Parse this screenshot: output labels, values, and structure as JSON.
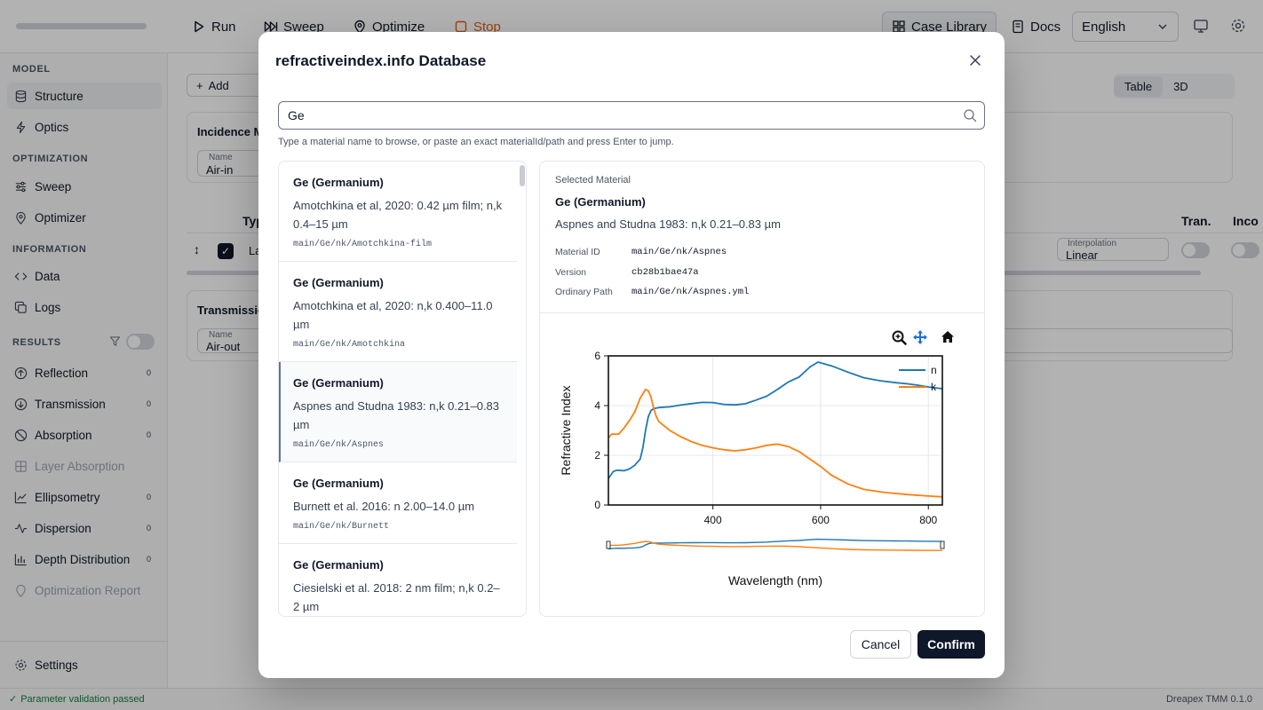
{
  "toolbar": {
    "run": "Run",
    "sweep": "Sweep",
    "optimize": "Optimize",
    "stop": "Stop",
    "case_library": "Case Library",
    "docs": "Docs",
    "language": "English"
  },
  "sidebar": {
    "model_heading": "MODEL",
    "structure": "Structure",
    "optics": "Optics",
    "optimization_heading": "OPTIMIZATION",
    "sweep": "Sweep",
    "optimizer": "Optimizer",
    "information_heading": "INFORMATION",
    "data": "Data",
    "logs": "Logs",
    "results_heading": "RESULTS",
    "reflection": "Reflection",
    "reflection_count": "0",
    "transmission": "Transmission",
    "transmission_count": "0",
    "absorption": "Absorption",
    "absorption_count": "0",
    "layer_absorption": "Layer Absorption",
    "ellipsometry": "Ellipsometry",
    "ellipsometry_count": "0",
    "dispersion": "Dispersion",
    "dispersion_count": "0",
    "depth_distribution": "Depth Distribution",
    "depth_distribution_count": "0",
    "optimization_report": "Optimization Report",
    "settings": "Settings"
  },
  "main": {
    "add_label": "Add",
    "view_table": "Table",
    "view_3d": "3D",
    "incidence_title": "Incidence M",
    "incidence_name_label": "Name",
    "incidence_name_value": "Air-in",
    "transmission_title": "Transmissic",
    "transmission_name_label": "Name",
    "transmission_name_value": "Air-out",
    "col_type": "Typ",
    "col_tran": "Tran.",
    "col_inco": "Inco",
    "layer_name": "La",
    "interpolation_label": "Interpolation",
    "interpolation_value": "Linear"
  },
  "status": {
    "validation": "Parameter validation passed",
    "version": "Dreapex TMM 0.1.0"
  },
  "modal": {
    "title": "refractiveindex.info Database",
    "search_value": "Ge",
    "hint": "Type a material name to browse, or paste an exact materialId/path and press Enter to jump.",
    "results": [
      {
        "title": "Ge (Germanium)",
        "desc": "Amotchkina et al, 2020: 0.42 µm film; n,k 0.4–15 µm",
        "path": "main/Ge/nk/Amotchkina-film"
      },
      {
        "title": "Ge (Germanium)",
        "desc": "Amotchkina et al, 2020: n,k 0.400–11.0 µm",
        "path": "main/Ge/nk/Amotchkina"
      },
      {
        "title": "Ge (Germanium)",
        "desc": "Aspnes and Studna 1983: n,k 0.21–0.83 µm",
        "path": "main/Ge/nk/Aspnes"
      },
      {
        "title": "Ge (Germanium)",
        "desc": "Burnett et al. 2016: n 2.00–14.0 µm",
        "path": "main/Ge/nk/Burnett"
      },
      {
        "title": "Ge (Germanium)",
        "desc": "Ciesielski et al. 2018: 2 nm film; n,k 0.2–2 µm",
        "path": ""
      }
    ],
    "selected": {
      "label": "Selected Material",
      "name": "Ge (Germanium)",
      "desc": "Aspnes and Studna 1983: n,k 0.21–0.83 µm",
      "material_id_label": "Material ID",
      "material_id": "main/Ge/nk/Aspnes",
      "version_label": "Version",
      "version": "cb28b1bae47a",
      "path_label": "Ordinary Path",
      "path": "main/Ge/nk/Aspnes.yml"
    },
    "cancel": "Cancel",
    "confirm": "Confirm"
  },
  "chart_data": {
    "type": "line",
    "xlabel": "Wavelength (nm)",
    "ylabel": "Refractive Index",
    "xlim": [
      206,
      826
    ],
    "ylim": [
      0,
      6
    ],
    "xticks": [
      400,
      600,
      800
    ],
    "yticks": [
      0,
      2,
      4,
      6
    ],
    "grid": true,
    "legend_position": "top-right",
    "series": [
      {
        "name": "n",
        "color": "#1f77b4",
        "x": [
          206,
          215,
          222,
          235,
          245,
          255,
          265,
          270,
          275,
          280,
          285,
          290,
          295,
          300,
          320,
          340,
          360,
          380,
          400,
          420,
          440,
          460,
          480,
          500,
          520,
          540,
          560,
          580,
          595,
          620,
          650,
          680,
          710,
          740,
          760,
          780,
          800,
          826
        ],
        "y": [
          1.06,
          1.35,
          1.4,
          1.38,
          1.45,
          1.6,
          1.85,
          2.3,
          3.0,
          3.55,
          3.8,
          3.88,
          3.9,
          3.92,
          3.95,
          4.02,
          4.08,
          4.13,
          4.12,
          4.05,
          4.03,
          4.07,
          4.22,
          4.38,
          4.65,
          4.95,
          5.15,
          5.55,
          5.75,
          5.6,
          5.35,
          5.12,
          5.0,
          4.92,
          4.88,
          4.82,
          4.75,
          4.68
        ]
      },
      {
        "name": "k",
        "color": "#ff7f0e",
        "x": [
          206,
          212,
          218,
          225,
          235,
          245,
          255,
          265,
          275,
          280,
          285,
          290,
          295,
          300,
          320,
          340,
          360,
          380,
          400,
          420,
          440,
          460,
          480,
          500,
          520,
          540,
          560,
          580,
          600,
          620,
          650,
          680,
          720,
          760,
          800,
          826
        ],
        "y": [
          2.7,
          2.85,
          2.85,
          2.85,
          3.1,
          3.4,
          3.75,
          4.3,
          4.65,
          4.6,
          4.35,
          3.9,
          3.55,
          3.35,
          3.0,
          2.75,
          2.55,
          2.4,
          2.3,
          2.22,
          2.18,
          2.22,
          2.3,
          2.4,
          2.45,
          2.35,
          2.15,
          1.85,
          1.55,
          1.2,
          0.85,
          0.63,
          0.5,
          0.42,
          0.36,
          0.33
        ]
      }
    ]
  },
  "chart_toolbar": {
    "zoom": "zoom-icon",
    "pan": "pan-icon",
    "home": "home-icon"
  }
}
